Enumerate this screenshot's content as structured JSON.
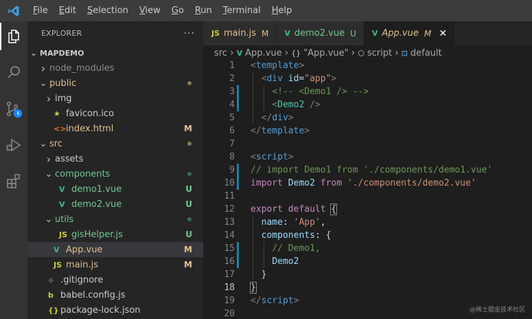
{
  "menu": [
    {
      "pre": "",
      "m": "F",
      "post": "ile"
    },
    {
      "pre": "",
      "m": "E",
      "post": "dit"
    },
    {
      "pre": "",
      "m": "S",
      "post": "election"
    },
    {
      "pre": "",
      "m": "V",
      "post": "iew"
    },
    {
      "pre": "",
      "m": "G",
      "post": "o"
    },
    {
      "pre": "",
      "m": "R",
      "post": "un"
    },
    {
      "pre": "",
      "m": "T",
      "post": "erminal"
    },
    {
      "pre": "",
      "m": "H",
      "post": "elp"
    }
  ],
  "activity_icons": [
    "explorer-icon",
    "search-icon",
    "source-control-icon",
    "run-debug-icon",
    "extensions-icon"
  ],
  "explorer": {
    "title": "EXPLORER",
    "more": "···",
    "project": "MAPDEMO",
    "tree": [
      {
        "label": "node_modules",
        "kind": "folder",
        "depth": 1,
        "open": false,
        "color": "#8c8c8c"
      },
      {
        "label": "public",
        "kind": "folder",
        "depth": 1,
        "open": true,
        "color": "#e2c08d",
        "dot": "#8a7a5a"
      },
      {
        "label": "img",
        "kind": "folder",
        "depth": 2,
        "open": false,
        "color": "#cccccc"
      },
      {
        "label": "favicon.ico",
        "kind": "file",
        "icon": "★",
        "iconColor": "#cbcb41",
        "depth": 2,
        "color": "#cccccc"
      },
      {
        "label": "index.html",
        "kind": "file",
        "icon": "<>",
        "iconColor": "#e37933",
        "depth": 2,
        "color": "#e2c08d",
        "deco": "M"
      },
      {
        "label": "src",
        "kind": "folder",
        "depth": 1,
        "open": true,
        "color": "#e2c08d",
        "dot": "#8a7a5a"
      },
      {
        "label": "assets",
        "kind": "folder",
        "depth": 2,
        "open": false,
        "color": "#cccccc"
      },
      {
        "label": "components",
        "kind": "folder",
        "depth": 2,
        "open": true,
        "color": "#73c991",
        "dot": "#3e6b4a"
      },
      {
        "label": "demo1.vue",
        "kind": "file",
        "icon": "V",
        "iconColor": "#41b883",
        "depth": 3,
        "color": "#73c991",
        "deco": "U"
      },
      {
        "label": "demo2.vue",
        "kind": "file",
        "icon": "V",
        "iconColor": "#41b883",
        "depth": 3,
        "color": "#73c991",
        "deco": "U"
      },
      {
        "label": "utils",
        "kind": "folder",
        "depth": 2,
        "open": true,
        "color": "#73c991",
        "dot": "#3e6b4a"
      },
      {
        "label": "gisHelper.js",
        "kind": "file",
        "icon": "JS",
        "iconColor": "#cbcb41",
        "depth": 3,
        "color": "#73c991",
        "deco": "U"
      },
      {
        "label": "App.vue",
        "kind": "file",
        "icon": "V",
        "iconColor": "#41b883",
        "depth": 2,
        "color": "#e2c08d",
        "deco": "M",
        "selected": true
      },
      {
        "label": "main.js",
        "kind": "file",
        "icon": "JS",
        "iconColor": "#cbcb41",
        "depth": 2,
        "color": "#e2c08d",
        "deco": "M"
      },
      {
        "label": ".gitignore",
        "kind": "file",
        "icon": "◆",
        "iconColor": "#41535b",
        "depth": 1,
        "color": "#cccccc"
      },
      {
        "label": "babel.config.js",
        "kind": "file",
        "icon": "b",
        "iconColor": "#cbcb41",
        "depth": 1,
        "color": "#cccccc"
      },
      {
        "label": "package-lock.json",
        "kind": "file",
        "icon": "{}",
        "iconColor": "#cbcb41",
        "depth": 1,
        "color": "#cccccc"
      }
    ]
  },
  "tabs": [
    {
      "label": "main.js",
      "icon": "JS",
      "iconColor": "#cbcb41",
      "color": "#e2c08d",
      "deco": "M",
      "active": false
    },
    {
      "label": "demo2.vue",
      "icon": "V",
      "iconColor": "#41b883",
      "color": "#73c991",
      "deco": "U",
      "active": false
    },
    {
      "label": "App.vue",
      "icon": "V",
      "iconColor": "#41b883",
      "color": "#e2c08d",
      "deco": "M",
      "active": true,
      "close": "✕"
    }
  ],
  "breadcrumb": [
    {
      "label": "src",
      "icon": ""
    },
    {
      "label": "App.vue",
      "icon": "V"
    },
    {
      "label": "\"App.vue\"",
      "icon": "{}"
    },
    {
      "label": "script",
      "icon": "⬡"
    },
    {
      "label": "default",
      "icon": "⊡"
    }
  ],
  "code": {
    "current_line": 18,
    "lines": [
      {
        "n": 1,
        "tokens": [
          [
            "t-br",
            "<"
          ],
          [
            "t-tag",
            "template"
          ],
          [
            "t-br",
            ">"
          ]
        ]
      },
      {
        "n": 2,
        "tokens": [
          [
            "t-def",
            "  "
          ],
          [
            "t-br",
            "<"
          ],
          [
            "t-tag",
            "div"
          ],
          [
            "t-def",
            " "
          ],
          [
            "t-attr",
            "id"
          ],
          [
            "t-def",
            "="
          ],
          [
            "t-str",
            "\"app\""
          ],
          [
            "t-br",
            ">"
          ]
        ]
      },
      {
        "n": 3,
        "mark": true,
        "tokens": [
          [
            "t-def",
            "    "
          ],
          [
            "t-com",
            "<!-- <Demo1 /> -->"
          ]
        ]
      },
      {
        "n": 4,
        "mark": true,
        "tokens": [
          [
            "t-def",
            "    "
          ],
          [
            "t-br",
            "<"
          ],
          [
            "t-comp",
            "Demo2"
          ],
          [
            "t-def",
            " "
          ],
          [
            "t-br",
            "/>"
          ]
        ]
      },
      {
        "n": 5,
        "tokens": [
          [
            "t-def",
            "  "
          ],
          [
            "t-br",
            "</"
          ],
          [
            "t-tag",
            "div"
          ],
          [
            "t-br",
            ">"
          ]
        ]
      },
      {
        "n": 6,
        "tokens": [
          [
            "t-br",
            "</"
          ],
          [
            "t-tag",
            "template"
          ],
          [
            "t-br",
            ">"
          ]
        ]
      },
      {
        "n": 7,
        "tokens": []
      },
      {
        "n": 8,
        "tokens": [
          [
            "t-br",
            "<"
          ],
          [
            "t-tag",
            "script"
          ],
          [
            "t-br",
            ">"
          ]
        ]
      },
      {
        "n": 9,
        "mark": true,
        "tokens": [
          [
            "t-com",
            "// import Demo1 from './components/demo1.vue'"
          ]
        ]
      },
      {
        "n": 10,
        "mark": true,
        "tokens": [
          [
            "t-kw",
            "import"
          ],
          [
            "t-def",
            " "
          ],
          [
            "t-attr",
            "Demo2"
          ],
          [
            "t-def",
            " "
          ],
          [
            "t-kw",
            "from"
          ],
          [
            "t-def",
            " "
          ],
          [
            "t-str",
            "'./components/demo2.vue'"
          ]
        ]
      },
      {
        "n": 11,
        "tokens": []
      },
      {
        "n": 12,
        "tokens": [
          [
            "t-kw",
            "export"
          ],
          [
            "t-def",
            " "
          ],
          [
            "t-kw",
            "default"
          ],
          [
            "t-def",
            " {"
          ]
        ]
      },
      {
        "n": 13,
        "tokens": [
          [
            "t-def",
            "  "
          ],
          [
            "t-attr",
            "name"
          ],
          [
            "t-def",
            ": "
          ],
          [
            "t-str",
            "'App'"
          ],
          [
            "t-def",
            ","
          ]
        ]
      },
      {
        "n": 14,
        "tokens": [
          [
            "t-def",
            "  "
          ],
          [
            "t-attr",
            "components"
          ],
          [
            "t-def",
            ": {"
          ]
        ]
      },
      {
        "n": 15,
        "mark": true,
        "tokens": [
          [
            "t-def",
            "    "
          ],
          [
            "t-com",
            "// Demo1,"
          ]
        ]
      },
      {
        "n": 16,
        "mark": true,
        "tokens": [
          [
            "t-def",
            "    "
          ],
          [
            "t-attr",
            "Demo2"
          ]
        ]
      },
      {
        "n": 17,
        "tokens": [
          [
            "t-def",
            "  }"
          ]
        ]
      },
      {
        "n": 18,
        "tokens": [
          [
            "t-def",
            "}"
          ]
        ]
      },
      {
        "n": 19,
        "tokens": [
          [
            "t-br",
            "</"
          ],
          [
            "t-tag",
            "script"
          ],
          [
            "t-br",
            ">"
          ]
        ]
      },
      {
        "n": 20,
        "tokens": []
      }
    ]
  },
  "watermark": "@稀土掘金技术社区"
}
